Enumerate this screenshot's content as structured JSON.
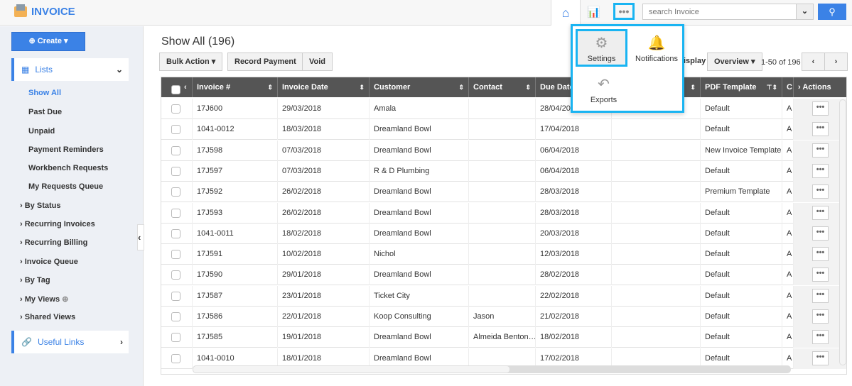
{
  "app": {
    "title": "INVOICE"
  },
  "nav": {
    "home_icon": "home-icon",
    "chart_icon": "bar-chart-icon",
    "more_label": "•••",
    "search_placeholder": "search Invoice"
  },
  "more_menu": {
    "items": [
      {
        "label": "Settings",
        "icon": "gear-icon"
      },
      {
        "label": "Notifications",
        "icon": "bell-icon"
      },
      {
        "label": "Exports",
        "icon": "export-arrow-icon"
      }
    ]
  },
  "sidebar": {
    "create": "Create",
    "lists": "Lists",
    "list_items": [
      "Show All",
      "Past Due",
      "Unpaid",
      "Payment Reminders",
      "Workbench Requests",
      "My Requests Queue"
    ],
    "groups": [
      "By Status",
      "Recurring Invoices",
      "Recurring Billing",
      "Invoice Queue",
      "By Tag",
      "My Views",
      "Shared Views"
    ],
    "useful_links": "Useful Links"
  },
  "main": {
    "title": "Show All (196)",
    "bulk_action": "Bulk Action",
    "record_payment": "Record Payment",
    "void": "Void",
    "display_label": "isplay",
    "display_value": "Overview",
    "pagination": "1-50 of 196"
  },
  "table": {
    "columns": [
      "Invoice #",
      "Invoice Date",
      "Customer",
      "Contact",
      "Due Date",
      "",
      "PDF Template",
      "C",
      "Actions"
    ],
    "rows": [
      [
        "17J600",
        "29/03/2018",
        "Amala",
        "",
        "28/04/2018",
        "",
        "Default",
        "A"
      ],
      [
        "1041-0012",
        "18/03/2018",
        "Dreamland Bowl",
        "",
        "17/04/2018",
        "",
        "Default",
        "A"
      ],
      [
        "17J598",
        "07/03/2018",
        "Dreamland Bowl",
        "",
        "06/04/2018",
        "",
        "New Invoice Template",
        "A"
      ],
      [
        "17J597",
        "07/03/2018",
        "R & D Plumbing",
        "",
        "06/04/2018",
        "",
        "Default",
        "A"
      ],
      [
        "17J592",
        "26/02/2018",
        "Dreamland Bowl",
        "",
        "28/03/2018",
        "",
        "Premium Template",
        "A"
      ],
      [
        "17J593",
        "26/02/2018",
        "Dreamland Bowl",
        "",
        "28/03/2018",
        "",
        "Default",
        "A"
      ],
      [
        "1041-0011",
        "18/02/2018",
        "Dreamland Bowl",
        "",
        "20/03/2018",
        "",
        "Default",
        "A"
      ],
      [
        "17J591",
        "10/02/2018",
        "Nichol",
        "",
        "12/03/2018",
        "",
        "Default",
        "A"
      ],
      [
        "17J590",
        "29/01/2018",
        "Dreamland Bowl",
        "",
        "28/02/2018",
        "",
        "Default",
        "A"
      ],
      [
        "17J587",
        "23/01/2018",
        "Ticket City",
        "",
        "22/02/2018",
        "",
        "Default",
        "A"
      ],
      [
        "17J586",
        "22/01/2018",
        "Koop Consulting",
        "Jason",
        "21/02/2018",
        "",
        "Default",
        "A"
      ],
      [
        "17J585",
        "19/01/2018",
        "Dreamland Bowl",
        "Almeida Benton…",
        "18/02/2018",
        "",
        "Default",
        "A"
      ],
      [
        "1041-0010",
        "18/01/2018",
        "Dreamland Bowl",
        "",
        "17/02/2018",
        "",
        "Default",
        "A"
      ]
    ],
    "row_action": "•••"
  },
  "colors": {
    "accent": "#3b82e6",
    "highlight": "#19b4f2",
    "table_header": "#555555"
  }
}
